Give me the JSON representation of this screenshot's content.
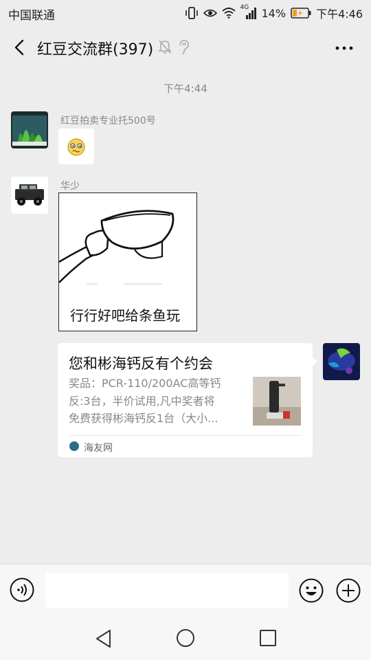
{
  "status_bar": {
    "carrier": "中国联通",
    "network": "4G",
    "battery": "14%",
    "time": "下午4:46"
  },
  "header": {
    "title": "红豆交流群(397)",
    "icons": [
      "back-arrow-icon",
      "mute-bell-icon",
      "ear-icon",
      "more-icon"
    ]
  },
  "chat": {
    "timestamp": "下午4:44",
    "messages": [
      {
        "sender": "红豆拍卖专业托500号",
        "type": "emoji",
        "content": "confused-face-emoji"
      },
      {
        "sender": "华少",
        "type": "image",
        "caption": "行行好吧给条鱼玩"
      },
      {
        "sender": "",
        "type": "link-card",
        "title": "您和彬海钙反有个约会",
        "desc_lines": [
          "奖品：PCR-110/200AC高等钙",
          "反:3台，半价试用,凡中奖者将",
          "免费获得彬海钙反1台（大小..."
        ],
        "source": "海友网"
      }
    ]
  },
  "input_bar": {
    "placeholder": "",
    "icons": [
      "voice-icon",
      "emoji-icon",
      "plus-icon"
    ]
  },
  "nav_bar": {
    "icons": [
      "nav-back-icon",
      "nav-home-icon",
      "nav-recent-icon"
    ]
  },
  "colors": {
    "background": "#ededed",
    "bubble": "#ffffff",
    "muted_text": "#888888"
  }
}
